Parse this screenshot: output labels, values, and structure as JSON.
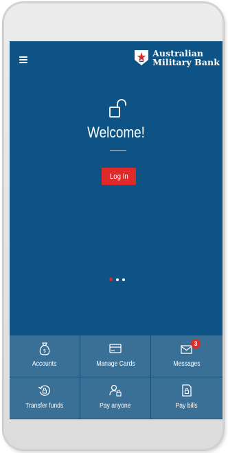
{
  "brand": {
    "line1": "Australian",
    "line2": "Military Bank"
  },
  "hero": {
    "title": "Welcome!",
    "login_label": "Log In"
  },
  "carousel": {
    "total": 3,
    "active_index": 0
  },
  "tiles": [
    {
      "label": "Accounts",
      "icon": "money-bag-icon"
    },
    {
      "label": "Manage Cards",
      "icon": "card-icon"
    },
    {
      "label": "Messages",
      "icon": "envelope-icon",
      "badge": "3"
    },
    {
      "label": "Transfer funds",
      "icon": "transfer-icon"
    },
    {
      "label": "Pay anyone",
      "icon": "pay-anyone-icon"
    },
    {
      "label": "Pay bills",
      "icon": "bill-icon"
    }
  ],
  "colors": {
    "background": "#0d5385",
    "tile": "#3a6f96",
    "accent": "#e02a2a",
    "text": "#ffffff"
  }
}
